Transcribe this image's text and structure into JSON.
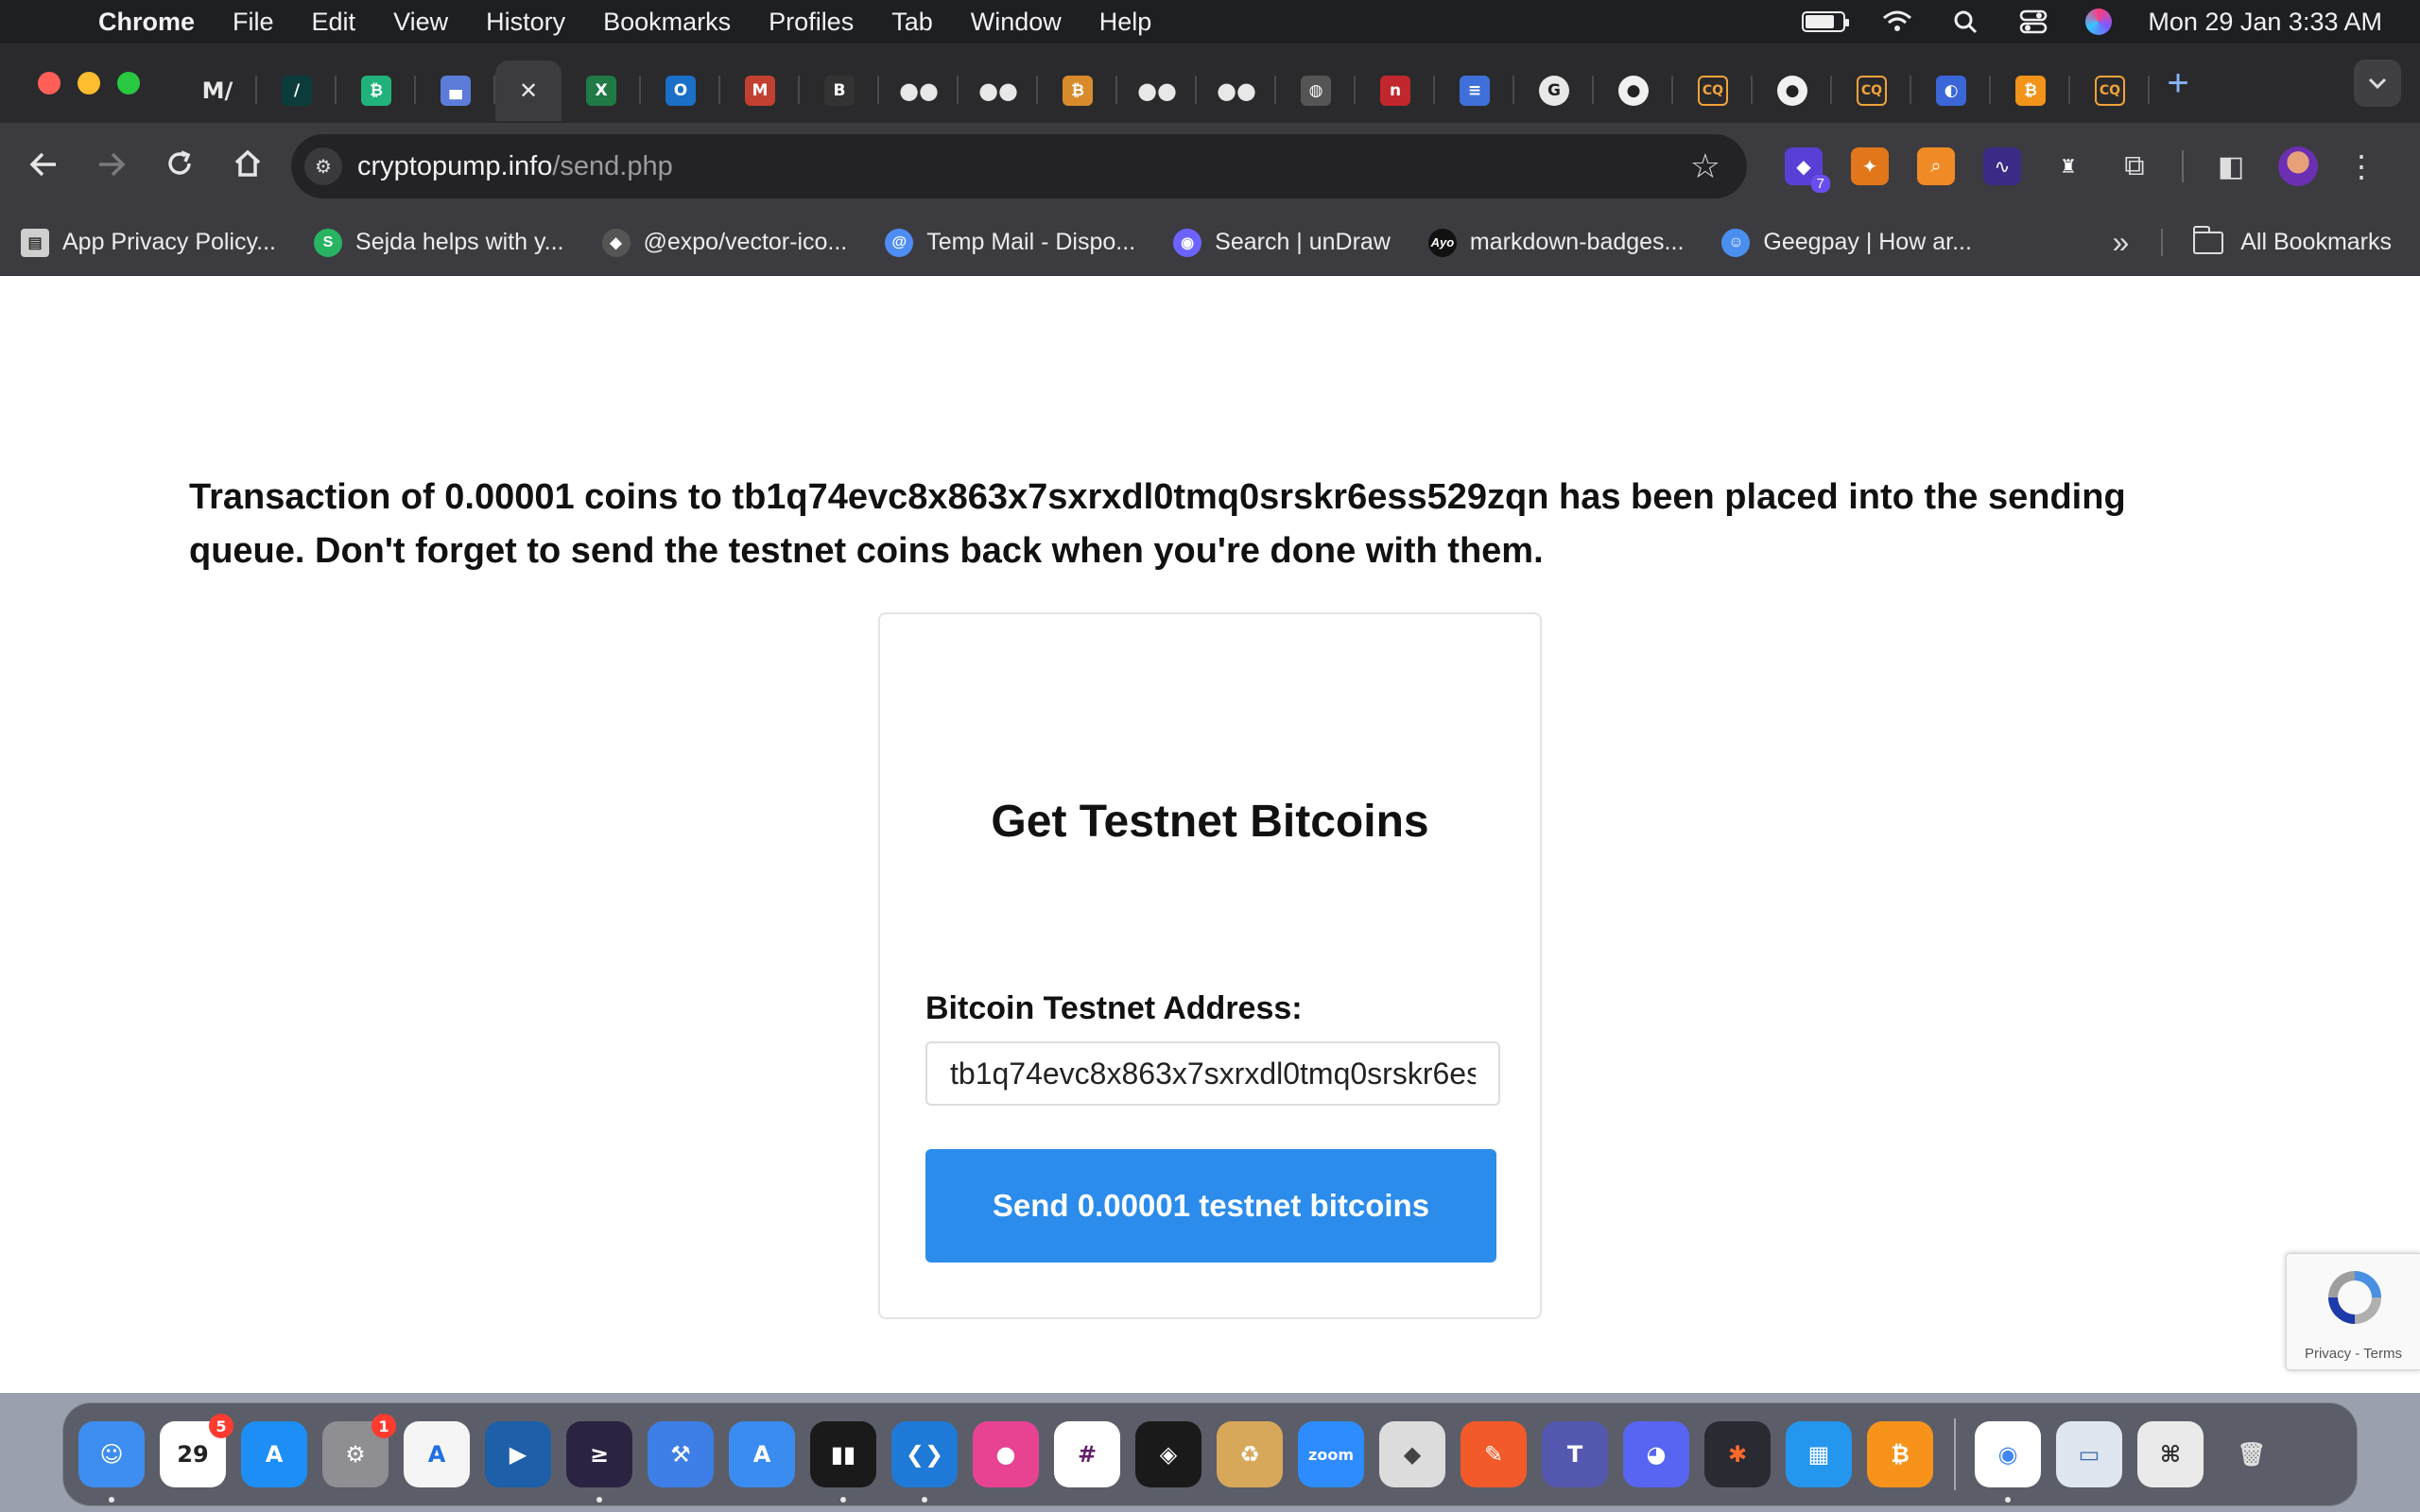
{
  "menubar": {
    "app_name": "Chrome",
    "menus": [
      "File",
      "Edit",
      "View",
      "History",
      "Bookmarks",
      "Profiles",
      "Tab",
      "Window",
      "Help"
    ],
    "datetime": "Mon 29 Jan  3:33 AM"
  },
  "tabs": [
    {
      "icon": "medium-m-icon",
      "glyph": "M/",
      "color": "transparent"
    },
    {
      "icon": "vercel-v-icon",
      "glyph": "/",
      "color": "#0b3b3b"
    },
    {
      "icon": "bitcoin-green-icon",
      "glyph": "₿",
      "color": "#21b27b"
    },
    {
      "icon": "dashboard-icon",
      "glyph": "▄",
      "color": "#5b7cd9"
    },
    {
      "icon": "close-icon",
      "glyph": "✕",
      "color": "transparent",
      "active": true
    },
    {
      "icon": "excel-icon",
      "glyph": "X",
      "color": "#1f7a45"
    },
    {
      "icon": "outlook-icon",
      "glyph": "O",
      "color": "#1a6fc7"
    },
    {
      "icon": "gmail-100-icon",
      "glyph": "M",
      "color": "#c2402f"
    },
    {
      "icon": "brush-icon",
      "glyph": "B",
      "color": "#333"
    },
    {
      "icon": "medium-dots-icon",
      "glyph": "●●",
      "color": "transparent"
    },
    {
      "icon": "medium-dots-icon",
      "glyph": "●●",
      "color": "transparent"
    },
    {
      "icon": "coin-icon",
      "glyph": "₿",
      "color": "#d98a2b"
    },
    {
      "icon": "medium-dots-icon",
      "glyph": "●●",
      "color": "transparent"
    },
    {
      "icon": "medium-dots-icon",
      "glyph": "●●",
      "color": "transparent"
    },
    {
      "icon": "globe-icon",
      "glyph": "◍",
      "color": "#555"
    },
    {
      "icon": "n-red-icon",
      "glyph": "n",
      "color": "#c1272d"
    },
    {
      "icon": "list-icon",
      "glyph": "≡",
      "color": "#3f6fd8"
    },
    {
      "icon": "google-icon",
      "glyph": "G",
      "color": "#e8e8e8"
    },
    {
      "icon": "github-icon",
      "glyph": "●",
      "color": "#f0f0f0"
    },
    {
      "icon": "cq-icon",
      "glyph": "CQ",
      "color": "#2a2a2d"
    },
    {
      "icon": "github-icon",
      "glyph": "●",
      "color": "#f0f0f0"
    },
    {
      "icon": "cq-icon",
      "glyph": "CQ",
      "color": "#2a2a2d"
    },
    {
      "icon": "blue-circle-icon",
      "glyph": "◐",
      "color": "#3a66d8"
    },
    {
      "icon": "bitcoin-orange-icon",
      "glyph": "₿",
      "color": "#f2931a"
    },
    {
      "icon": "cq-icon",
      "glyph": "CQ",
      "color": "#2a2a2d"
    }
  ],
  "toolbar": {
    "url_host": "cryptopump.info",
    "url_path": "/send.php",
    "extension_badge": "7"
  },
  "bookmarks": [
    {
      "label": "App Privacy Policy...",
      "icon": "document-icon",
      "color": "#cfcfcf",
      "glyph": "▤"
    },
    {
      "label": "Sejda helps with y...",
      "icon": "sejda-icon",
      "color": "#28b463",
      "glyph": "S"
    },
    {
      "label": "@expo/vector-ico...",
      "icon": "npm-icon",
      "color": "#555",
      "glyph": "◆"
    },
    {
      "label": "Temp Mail - Dispo...",
      "icon": "at-sign-icon",
      "color": "#4e8df5",
      "glyph": "@"
    },
    {
      "label": "Search | unDraw",
      "icon": "undraw-icon",
      "color": "#6c63ff",
      "glyph": "◉"
    },
    {
      "label": "markdown-badges...",
      "icon": "ayo-icon",
      "color": "#111",
      "glyph": "A"
    },
    {
      "label": "Geegpay | How ar...",
      "icon": "emoji-icon",
      "color": "#4a8ff0",
      "glyph": "☺"
    }
  ],
  "bookmarks_all": "All Bookmarks",
  "page": {
    "message": "Transaction of 0.00001 coins to tb1q74evc8x863x7sxrxdl0tmq0srskr6ess529zqn has been placed into the sending queue. Don't forget to send the testnet coins back when you're done with them.",
    "card_title": "Get Testnet Bitcoins",
    "address_label": "Bitcoin Testnet Address:",
    "address_value": "tb1q74evc8x863x7sxrxdl0tmq0srskr6ess529zqn",
    "send_button": "Send 0.00001 testnet bitcoins",
    "recaptcha_terms": "Privacy - Terms"
  },
  "dock": {
    "apps": [
      {
        "name": "finder-icon",
        "color": "#3d8ef0",
        "glyph": "☺",
        "dot": true
      },
      {
        "name": "calendar-icon",
        "color": "#ffffff",
        "glyph": "29",
        "text_color": "#222",
        "badge": "5"
      },
      {
        "name": "app-store-icon",
        "color": "#1c8ef5",
        "glyph": "A"
      },
      {
        "name": "system-settings-icon",
        "color": "#8e8e93",
        "glyph": "⚙",
        "badge": "1"
      },
      {
        "name": "xcode-instruments-icon",
        "color": "#f5f5f5",
        "glyph": "A",
        "text_color": "#1f6fe5"
      },
      {
        "name": "remote-desktop-icon",
        "color": "#1d5fa8",
        "glyph": "▶"
      },
      {
        "name": "terminal-cat-icon",
        "color": "#2b2341",
        "glyph": "≥",
        "dot": true
      },
      {
        "name": "xcode-icon",
        "color": "#3d7fe6",
        "glyph": "⚒"
      },
      {
        "name": "simulator-icon",
        "color": "#3b8cf0",
        "glyph": "A"
      },
      {
        "name": "activity-monitor-icon",
        "color": "#1a1a1a",
        "glyph": "▮▮",
        "dot": true
      },
      {
        "name": "vscode-icon",
        "color": "#1e7ad6",
        "glyph": "❮❯",
        "dot": true
      },
      {
        "name": "color-picker-icon",
        "color": "#e84393",
        "glyph": "●"
      },
      {
        "name": "slack-icon",
        "color": "#ffffff",
        "glyph": "#",
        "text_color": "#611f69"
      },
      {
        "name": "cube-app-icon",
        "color": "#1a1a1a",
        "glyph": "◈"
      },
      {
        "name": "archive-utility-icon",
        "color": "#d8a85a",
        "glyph": "♻"
      },
      {
        "name": "zoom-icon",
        "color": "#2d8cff",
        "glyph": "zoom"
      },
      {
        "name": "bootcamp-icon",
        "color": "#dcdcdc",
        "glyph": "◆",
        "text_color": "#444"
      },
      {
        "name": "pen-app-icon",
        "color": "#f25a2a",
        "glyph": "✎"
      },
      {
        "name": "teams-icon",
        "color": "#5558af",
        "glyph": "T"
      },
      {
        "name": "discord-icon",
        "color": "#5865f2",
        "glyph": "◕"
      },
      {
        "name": "graph-app-icon",
        "color": "#2a2a33",
        "glyph": "✱",
        "text_color": "#ff6a2b"
      },
      {
        "name": "docker-icon",
        "color": "#2496ed",
        "glyph": "▦"
      },
      {
        "name": "bitcoin-app-icon",
        "color": "#f7931a",
        "glyph": "₿"
      }
    ],
    "right_apps": [
      {
        "name": "chrome-icon",
        "color": "#ffffff",
        "glyph": "◉",
        "text_color": "#4285f4",
        "dot": true
      },
      {
        "name": "preview-icon",
        "color": "#dfe6ef",
        "glyph": "▭",
        "text_color": "#3a6aa8"
      },
      {
        "name": "screenshot-icon",
        "color": "#eaeaea",
        "glyph": "⌘",
        "text_color": "#333"
      },
      {
        "name": "trash-icon",
        "color": "transparent",
        "glyph": "🗑",
        "text_color": "#e0e0e0"
      }
    ]
  }
}
